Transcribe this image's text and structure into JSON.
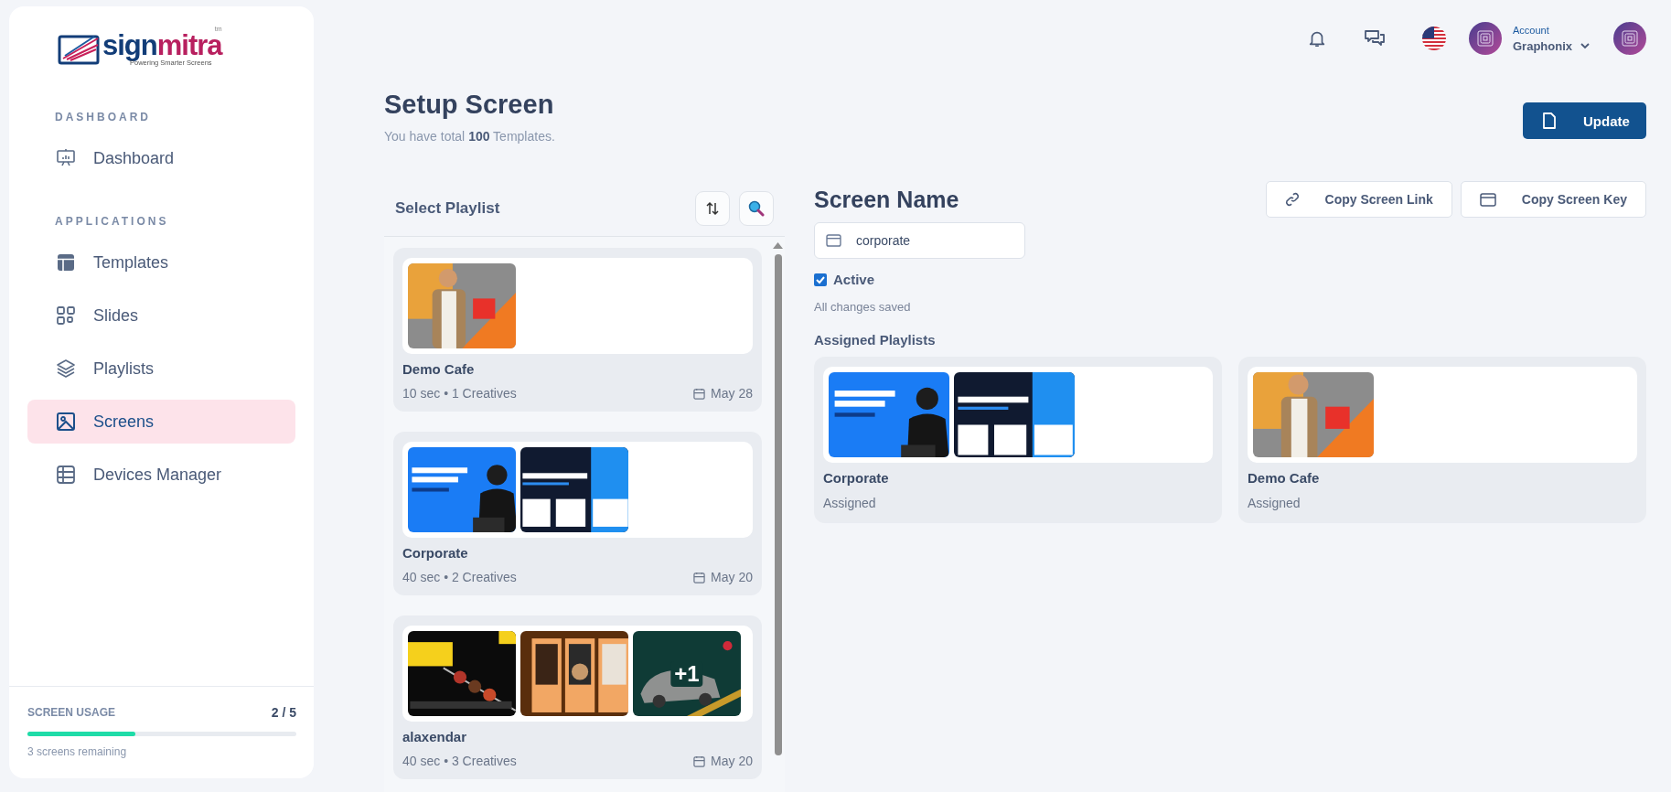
{
  "logo": {
    "brand_first": "sign",
    "brand_second": "mitra",
    "trademark": "tm",
    "tagline": "Powering Smarter Screens"
  },
  "sidebar": {
    "sections": [
      {
        "heading": "DASHBOARD",
        "items": [
          {
            "label": "Dashboard",
            "selected": false
          }
        ]
      },
      {
        "heading": "APPLICATIONS",
        "items": [
          {
            "label": "Templates",
            "selected": false
          },
          {
            "label": "Slides",
            "selected": false
          },
          {
            "label": "Playlists",
            "selected": false
          },
          {
            "label": "Screens",
            "selected": true
          },
          {
            "label": "Devices Manager",
            "selected": false
          }
        ]
      }
    ],
    "usage": {
      "label": "SCREEN USAGE",
      "count": "2 / 5",
      "level": 0.4,
      "note": "3 screens remaining"
    }
  },
  "header": {
    "account_label": "Account",
    "account_name": "Graphonix"
  },
  "page": {
    "title": "Setup Screen",
    "subtitle": "You have total **100** Templates.",
    "update_button": "Update"
  },
  "playlist_panel": {
    "title": "Select Playlist",
    "playlists": [
      {
        "name": "Demo Cafe",
        "meta": "10 sec • 1 Creatives",
        "date": "May 28"
      },
      {
        "name": "Corporate",
        "meta": "40 sec • 2 Creatives",
        "date": "May 20"
      },
      {
        "name": "alaxendar",
        "meta": "40 sec • 3 Creatives",
        "date": "May 20",
        "more": "+1"
      }
    ]
  },
  "screen": {
    "heading": "Screen Name",
    "copy_link": "Copy Screen Link",
    "copy_key": "Copy Screen Key",
    "name_value": "corporate",
    "active_label": "Active",
    "active": true,
    "status": "All changes saved",
    "assigned_title": "Assigned Playlists",
    "assigned": [
      {
        "name": "Corporate",
        "status": "Assigned"
      },
      {
        "name": "Demo Cafe",
        "status": "Assigned"
      }
    ]
  }
}
